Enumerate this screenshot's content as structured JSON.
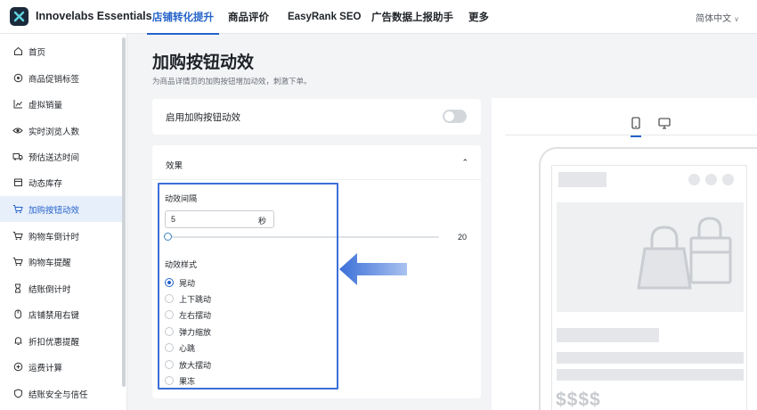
{
  "header": {
    "brand": "Innovelabs Essentials",
    "nav": [
      "店铺转化提升",
      "商品评价",
      "EasyRank SEO",
      "广告数据上报助手",
      "更多"
    ],
    "active_nav": "店铺转化提升",
    "language": "简体中文"
  },
  "sidebar": {
    "items": [
      {
        "label": "首页",
        "icon": "home-icon"
      },
      {
        "label": "商品促销标签",
        "icon": "badge-icon"
      },
      {
        "label": "虚拟销量",
        "icon": "chart-icon"
      },
      {
        "label": "实时浏览人数",
        "icon": "eye-icon"
      },
      {
        "label": "预估送达时间",
        "icon": "truck-icon"
      },
      {
        "label": "动态库存",
        "icon": "box-icon"
      },
      {
        "label": "加购按钮动效",
        "icon": "cart-icon"
      },
      {
        "label": "购物车倒计时",
        "icon": "cart-timer-icon"
      },
      {
        "label": "购物车提醒",
        "icon": "cart-icon"
      },
      {
        "label": "结账倒计时",
        "icon": "hourglass-icon"
      },
      {
        "label": "店铺禁用右键",
        "icon": "mouse-icon"
      },
      {
        "label": "折扣优惠提醒",
        "icon": "bell-icon"
      },
      {
        "label": "运费计算",
        "icon": "calculator-icon"
      },
      {
        "label": "结账安全与信任",
        "icon": "shield-icon"
      }
    ],
    "active_index": 6
  },
  "page": {
    "title": "加购按钮动效",
    "subtitle": "为商品详情页的加购按钮增加动效，刺激下单。"
  },
  "settings": {
    "enable_label": "启用加购按钮动效",
    "enabled": false,
    "effect_title": "效果",
    "interval_label": "动效间隔",
    "interval_value": "5",
    "interval_unit": "秒",
    "slider_max": "20",
    "slider_fraction": 0.0,
    "style_label": "动效样式",
    "styles": [
      "晃动",
      "上下跳动",
      "左右摆动",
      "弹力缩放",
      "心跳",
      "放大摆动",
      "果冻"
    ],
    "selected_style": "晃动"
  },
  "preview": {
    "devices": [
      "mobile-icon",
      "desktop-icon"
    ],
    "active_device": "mobile-icon",
    "price_placeholder": "$$$$"
  },
  "colors": {
    "accent": "#2563c9",
    "highlight": "#3b6fd8"
  }
}
